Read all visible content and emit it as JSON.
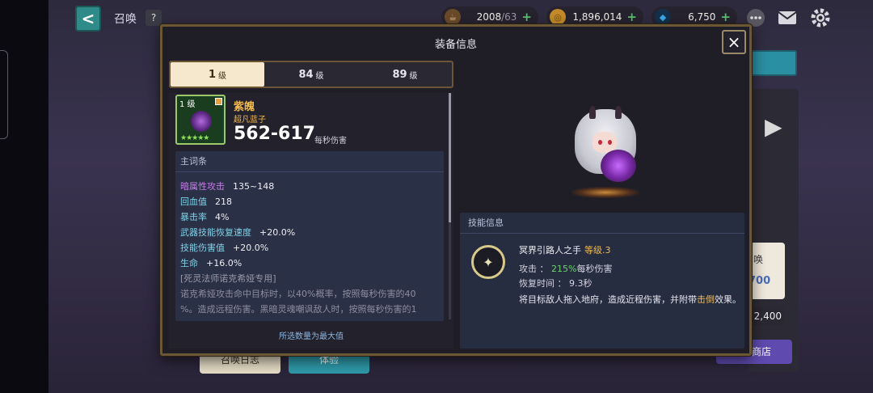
{
  "topbar": {
    "back": "<",
    "title": "召唤",
    "help": "?",
    "resources": [
      {
        "icon": "coffee-icon",
        "value": "2008",
        "max": "/63"
      },
      {
        "icon": "coin-icon",
        "value": "1,896,014"
      },
      {
        "icon": "diamond-icon",
        "value": "6,750"
      }
    ]
  },
  "background": {
    "card_text": "唤",
    "card_price": "700",
    "price2": "2,400",
    "shop": "商店",
    "log_button": "召唤日志",
    "try_button": "体验"
  },
  "modal": {
    "title": "装备信息",
    "close": "×",
    "tabs": [
      {
        "level": "1",
        "unit": "级"
      },
      {
        "level": "84",
        "unit": "级"
      },
      {
        "level": "89",
        "unit": "级"
      }
    ],
    "item": {
      "level": "1 级",
      "name": "紫魄",
      "grade": "超凡蓝子",
      "damage": "562-617",
      "damage_unit": "每秒伤害",
      "stars": "★★★★★"
    },
    "stats": {
      "header": "主词条",
      "rows": [
        {
          "k": "暗属性攻击",
          "v": "135~148"
        },
        {
          "k": "回血值",
          "v": "218"
        },
        {
          "k": "暴击率",
          "v": "4%"
        },
        {
          "k": "武器技能恢复速度",
          "v": "+20.0%"
        },
        {
          "k": "技能伤害值",
          "v": "+20.0%"
        },
        {
          "k": "生命",
          "v": "+16.0%"
        }
      ],
      "note": "[死灵法师诺克希娅专用]",
      "desc1": "诺克希娅攻击命中目标时，以40%概率，按照每秒伤害的40",
      "desc2": "%。造成远程伤害。黑暗灵魂嘲讽敌人时，按照每秒伤害的1"
    },
    "footer": "所选数量为最大值",
    "skill": {
      "header": "技能信息",
      "name": "冥界引路人之手",
      "level": "等级.3",
      "attack_label": "攻击 ：",
      "attack_value": "215%",
      "attack_unit": "每秒伤害",
      "cooldown_label": "恢复时间 ：",
      "cooldown_value": "9.3秒",
      "desc_pre": "将目标敌人拖入地府，造成近程伤害，并附带",
      "desc_highlight": "击倒",
      "desc_post": "效果。"
    }
  }
}
